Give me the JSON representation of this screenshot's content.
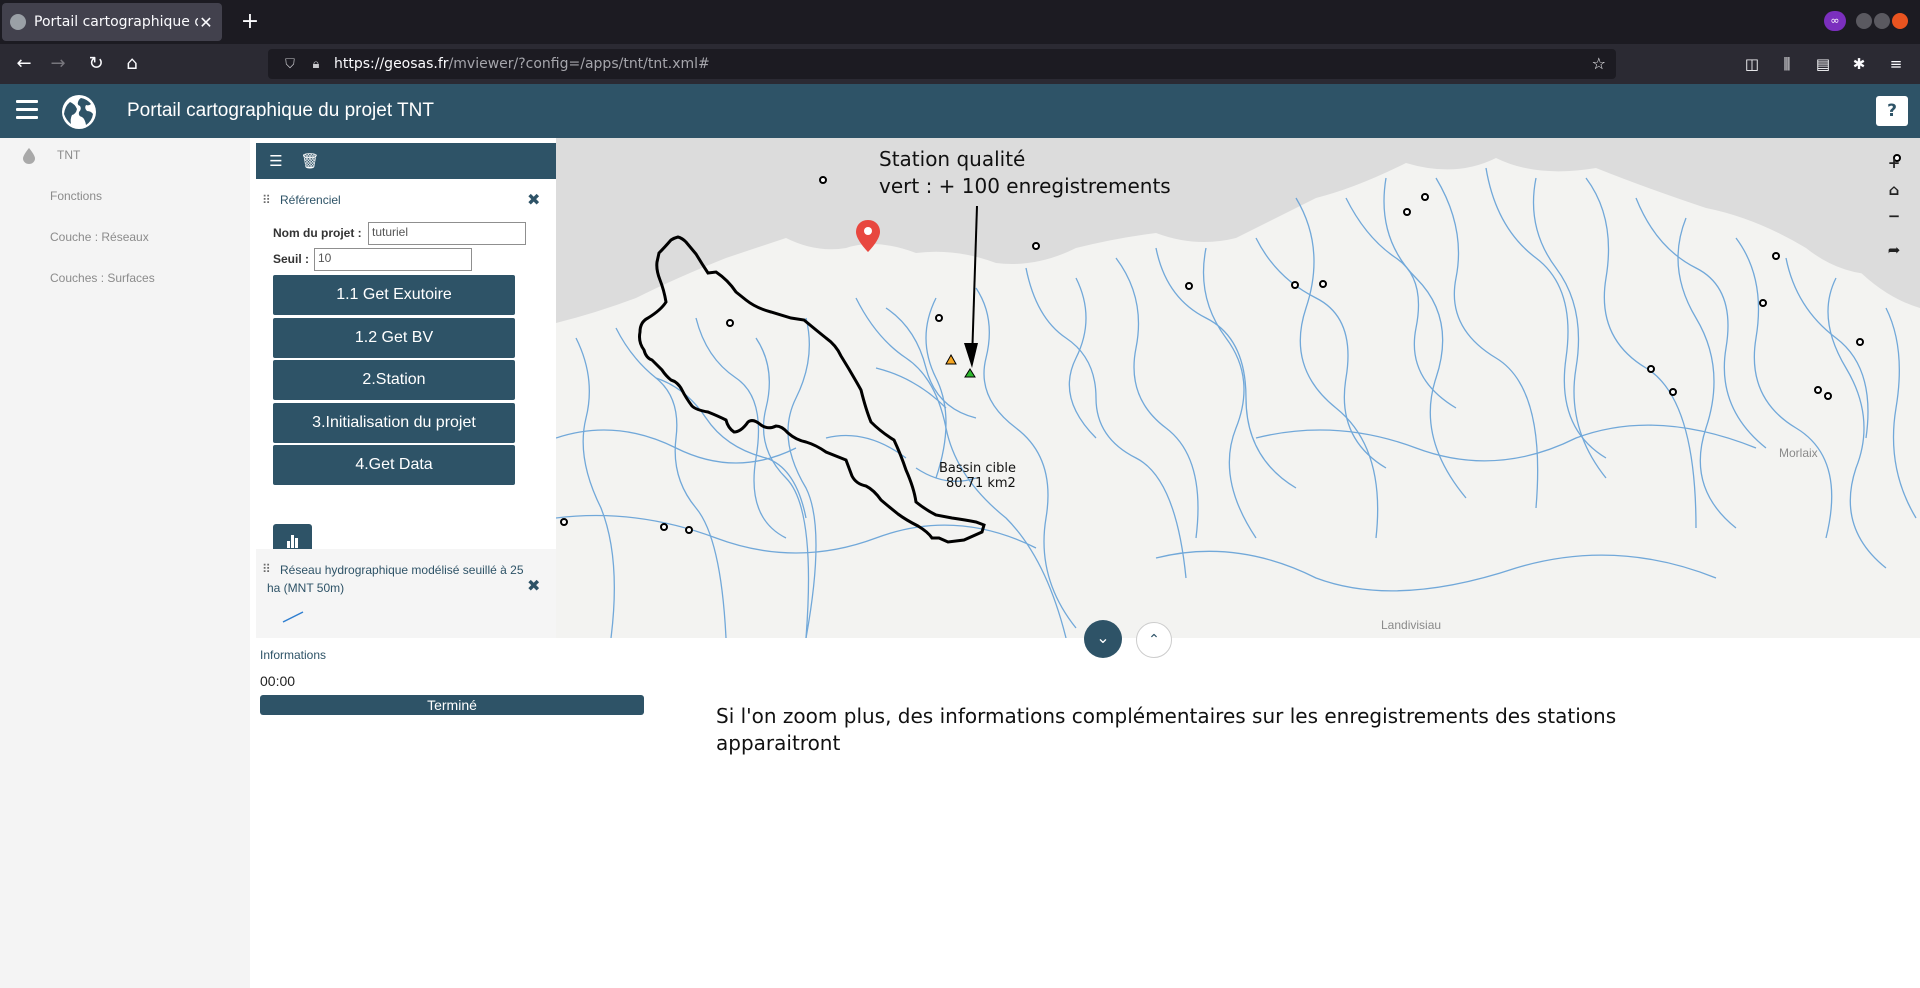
{
  "browser": {
    "tab_title": "Portail cartographique du projet TNT",
    "url_host": "https://geosas.fr",
    "url_path": "/mviewer/?config=/apps/tnt/tnt.xml#"
  },
  "app": {
    "title": "Portail cartographique du projet TNT",
    "help_label": "?"
  },
  "sidebar": {
    "items": [
      {
        "label": "TNT"
      },
      {
        "label": "Fonctions"
      },
      {
        "label": "Couche : Réseaux"
      },
      {
        "label": "Couches : Surfaces"
      }
    ]
  },
  "panel": {
    "referentiel": {
      "title": "Référenciel",
      "project_label": "Nom du projet :",
      "project_value": "tuturiel",
      "seuil_label": "Seuil :",
      "seuil_value": "10",
      "buttons": [
        {
          "label": "1.1 Get Exutoire"
        },
        {
          "label": "1.2 Get BV"
        },
        {
          "label": "2.Station"
        },
        {
          "label": "3.Initialisation du projet"
        },
        {
          "label": "4.Get Data"
        }
      ]
    },
    "reseau": {
      "title": "Réseau hydrographique modélisé seuillé à 25 ha (MNT 50m)"
    }
  },
  "info": {
    "title": "Informations",
    "time": "00:00",
    "status": "Terminé",
    "progress_fraction": 1.0
  },
  "map": {
    "annotation_top_line1": "Station qualité",
    "annotation_top_line2": "vert : + 100 enregistrements",
    "basin_label_line1": "Bassin cible",
    "basin_label_line2": "80.71 km2",
    "town_morlaix": "Morlaix",
    "town_landivisiau": "Landivisiau",
    "colors": {
      "river": "#5b9bd5",
      "basin_outline": "#000000",
      "marker": "#e8473f",
      "station_green": "#2eb82e",
      "station_orange": "#f5a623"
    }
  },
  "annotation_bottom": "Si l'on zoom plus, des informations complémentaires sur les enregistrements des stations apparaitront"
}
